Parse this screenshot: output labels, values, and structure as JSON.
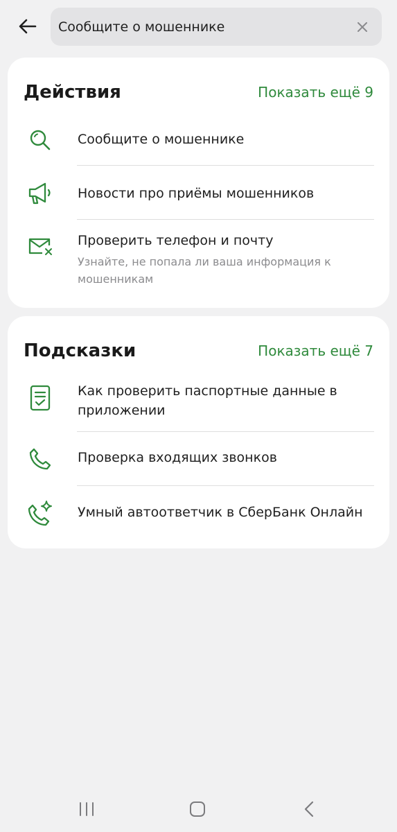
{
  "search": {
    "value": "Сообщите о мошеннике"
  },
  "actions": {
    "title": "Действия",
    "more": "Показать ещё 9",
    "items": [
      {
        "title": "Сообщите о мошеннике",
        "icon": "search-icon"
      },
      {
        "title": "Новости про приёмы мошенников",
        "icon": "megaphone-icon"
      },
      {
        "title": "Проверить телефон и почту",
        "subtitle": "Узнайте, не попала ли ваша информация к мошенникам",
        "icon": "mail-icon"
      }
    ]
  },
  "tips": {
    "title": "Подсказки",
    "more": "Показать ещё 7",
    "items": [
      {
        "title": "Как проверить паспортные данные в приложении",
        "icon": "document-check-icon"
      },
      {
        "title": "Проверка входящих звонков",
        "icon": "phone-icon"
      },
      {
        "title": "Умный автоответчик в СберБанк Онлайн",
        "icon": "phone-sparkle-icon"
      }
    ]
  },
  "colors": {
    "accent": "#2f8a3c",
    "background": "#f1f1f2",
    "card": "#ffffff"
  }
}
